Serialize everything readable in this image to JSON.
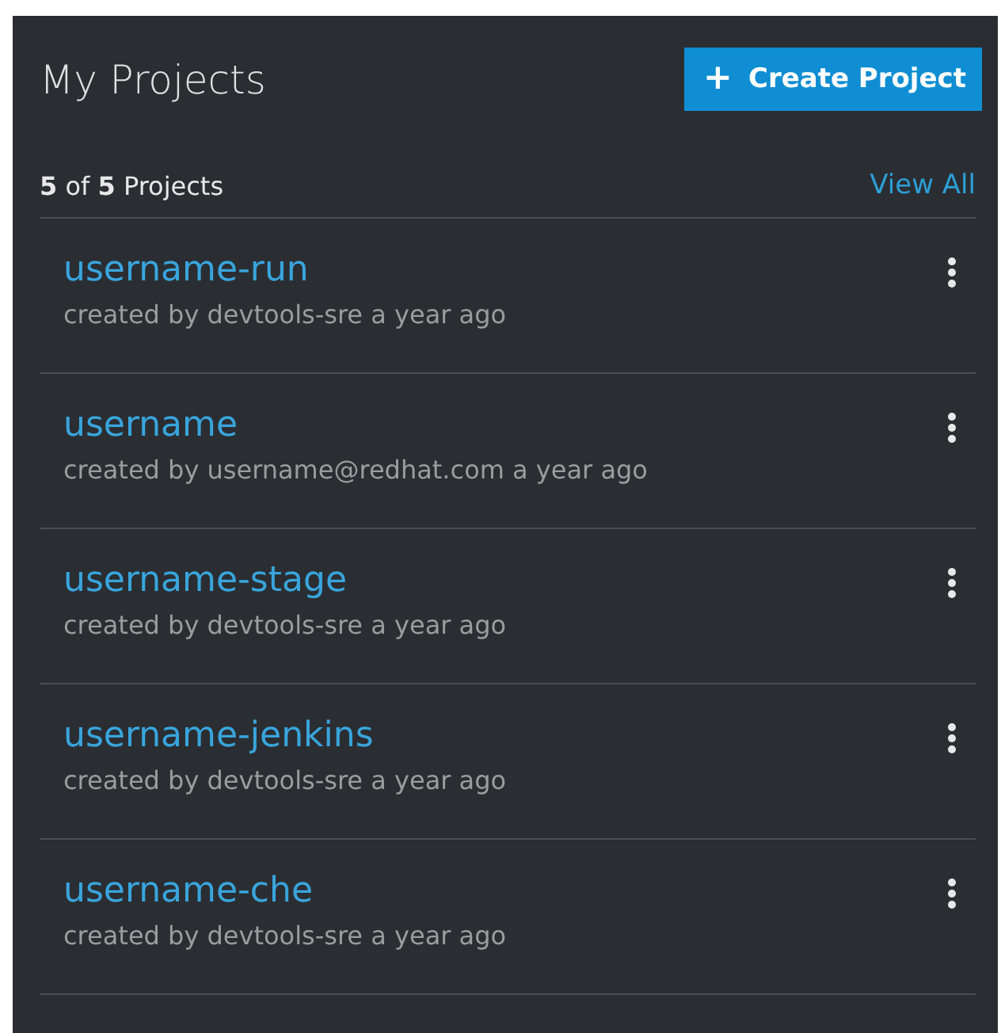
{
  "header": {
    "title": "My Projects",
    "create_button": {
      "icon": "+",
      "label": "Create Project"
    }
  },
  "summary": {
    "count": "**5** of **5** Projects",
    "view_all": "View All"
  },
  "projects": [
    {
      "name": "username-run",
      "meta": "created by devtools-sre a year ago"
    },
    {
      "name": "username",
      "meta": "created by username@redhat.com a year ago"
    },
    {
      "name": "username-stage",
      "meta": "created by devtools-sre a year ago"
    },
    {
      "name": "username-jenkins",
      "meta": "created by devtools-sre a year ago"
    },
    {
      "name": "username-che",
      "meta": "created by devtools-sre a year ago"
    }
  ]
}
